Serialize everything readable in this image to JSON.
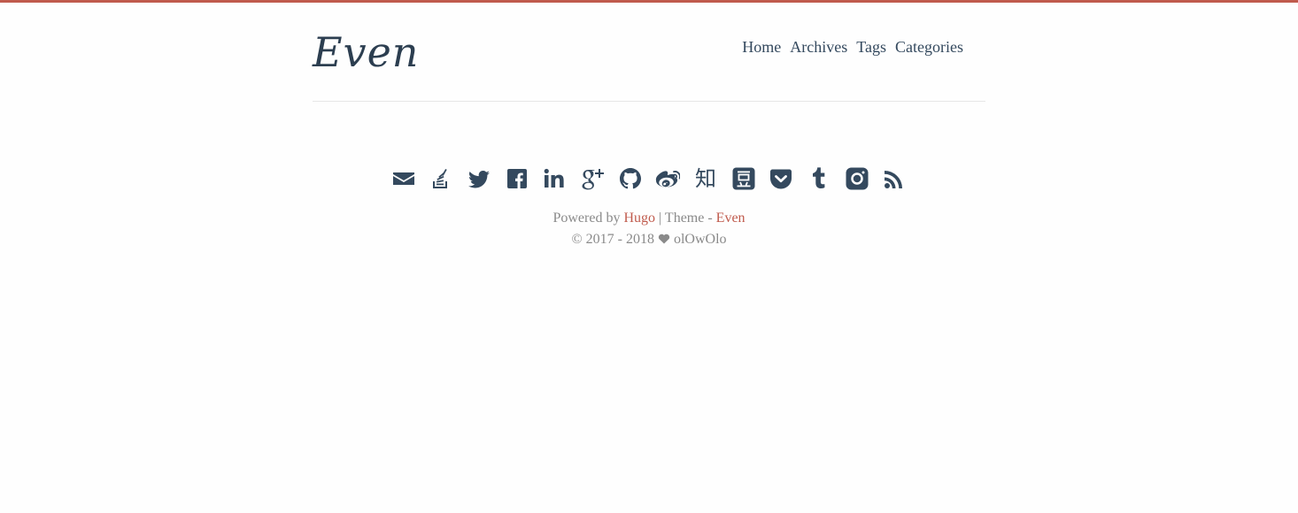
{
  "brand": {
    "title": "Even",
    "accent_color": "#c05b4d",
    "text_color": "#34495e"
  },
  "nav": {
    "items": [
      {
        "label": "Home"
      },
      {
        "label": "Archives"
      },
      {
        "label": "Tags"
      },
      {
        "label": "Categories"
      }
    ]
  },
  "social": {
    "icons": [
      "email-icon",
      "stack-overflow-icon",
      "twitter-icon",
      "facebook-icon",
      "linkedin-icon",
      "google-plus-icon",
      "github-icon",
      "weibo-icon",
      "zhihu-icon",
      "douban-icon",
      "pocket-icon",
      "tumblr-icon",
      "instagram-icon",
      "rss-icon"
    ],
    "zhihu_glyph": "知",
    "douban_glyph": "豆"
  },
  "footer": {
    "powered_by": "Powered by",
    "hugo_link": "Hugo",
    "separator": "| Theme -",
    "theme_link": "Even",
    "copyright_years": "© 2017 - 2018",
    "author": "olOwOlo"
  }
}
